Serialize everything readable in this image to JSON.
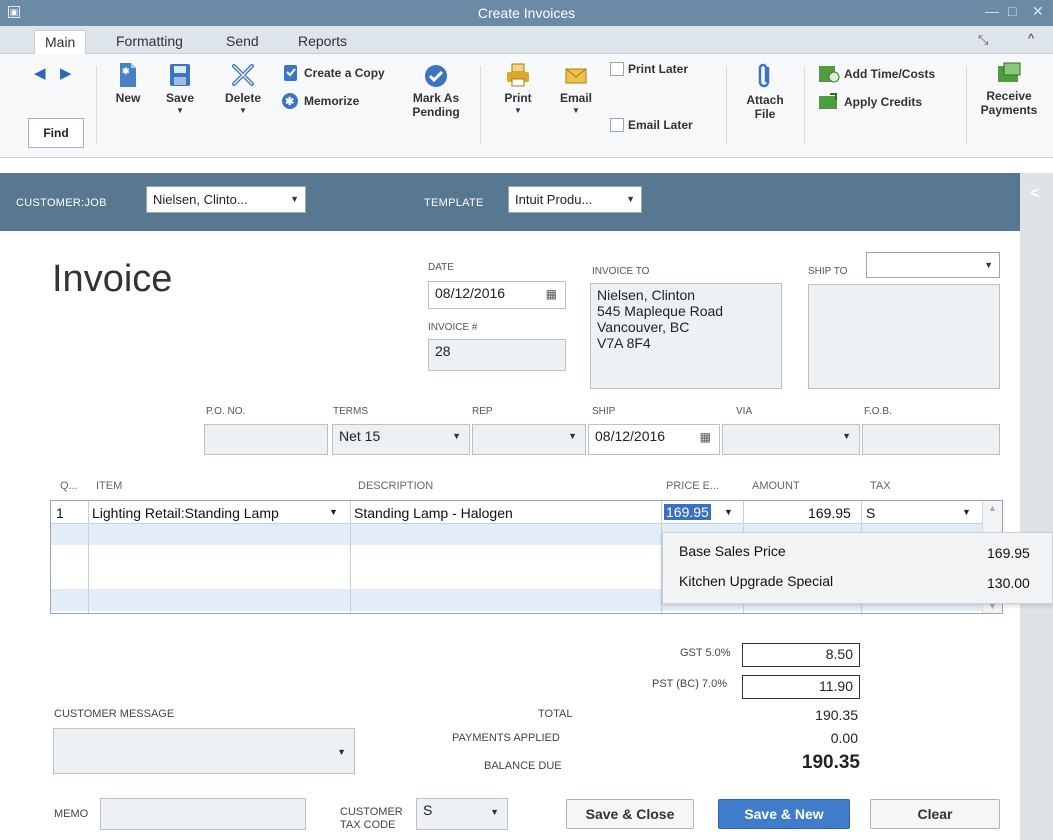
{
  "window": {
    "title": "Create Invoices"
  },
  "tabs": [
    {
      "label": "Main"
    },
    {
      "label": "Formatting"
    },
    {
      "label": "Send"
    },
    {
      "label": "Reports"
    }
  ],
  "toolbar": {
    "find": "Find",
    "new": "New",
    "save": "Save",
    "delete": "Delete",
    "create_copy": "Create a Copy",
    "memorize": "Memorize",
    "mark_pending_1": "Mark As",
    "mark_pending_2": "Pending",
    "print": "Print",
    "email": "Email",
    "print_later": "Print Later",
    "email_later": "Email Later",
    "attach_1": "Attach",
    "attach_2": "File",
    "add_time": "Add Time/Costs",
    "apply_credits": "Apply Credits",
    "receive_1": "Receive",
    "receive_2": "Payments"
  },
  "header": {
    "customer_label": "CUSTOMER:JOB",
    "customer_value": "Nielsen, Clinto...",
    "template_label": "TEMPLATE",
    "template_value": "Intuit Produ..."
  },
  "invoice": {
    "title": "Invoice",
    "date_label": "DATE",
    "date_value": "08/12/2016",
    "number_label": "INVOICE #",
    "number_value": "28",
    "invoice_to_label": "INVOICE TO",
    "invoice_to_lines": [
      "Nielsen, Clinton",
      "545 Mapleque Road",
      "Vancouver, BC",
      "V7A 8F4"
    ],
    "ship_to_label": "SHIP TO",
    "po_label": "P.O. NO.",
    "terms_label": "TERMS",
    "terms_value": "Net 15",
    "rep_label": "REP",
    "ship_label": "SHIP",
    "ship_value": "08/12/2016",
    "via_label": "VIA",
    "fob_label": "F.O.B."
  },
  "grid": {
    "headers": {
      "qty": "Q...",
      "item": "ITEM",
      "description": "DESCRIPTION",
      "price": "PRICE E...",
      "amount": "AMOUNT",
      "tax": "TAX"
    },
    "row1": {
      "qty": "1",
      "item": "Lighting Retail:Standing Lamp",
      "description": "Standing Lamp - Halogen",
      "price": "169.95",
      "amount": "169.95",
      "tax": "S"
    },
    "price_popup": [
      {
        "name": "Base Sales Price",
        "value": "169.95"
      },
      {
        "name": "Kitchen Upgrade Special",
        "value": "130.00"
      }
    ]
  },
  "totals": {
    "gst_label": "GST 5.0%",
    "gst_value": "8.50",
    "pst_label": "PST (BC) 7.0%",
    "pst_value": "11.90",
    "total_label": "TOTAL",
    "total_value": "190.35",
    "payments_label": "PAYMENTS APPLIED",
    "payments_value": "0.00",
    "balance_label": "BALANCE DUE",
    "balance_value": "190.35"
  },
  "footer": {
    "customer_message_label": "CUSTOMER MESSAGE",
    "memo_label": "MEMO",
    "tax_code_label_1": "CUSTOMER",
    "tax_code_label_2": "TAX CODE",
    "tax_code_value": "S",
    "save_close": "Save & Close",
    "save_new": "Save & New",
    "clear": "Clear"
  }
}
